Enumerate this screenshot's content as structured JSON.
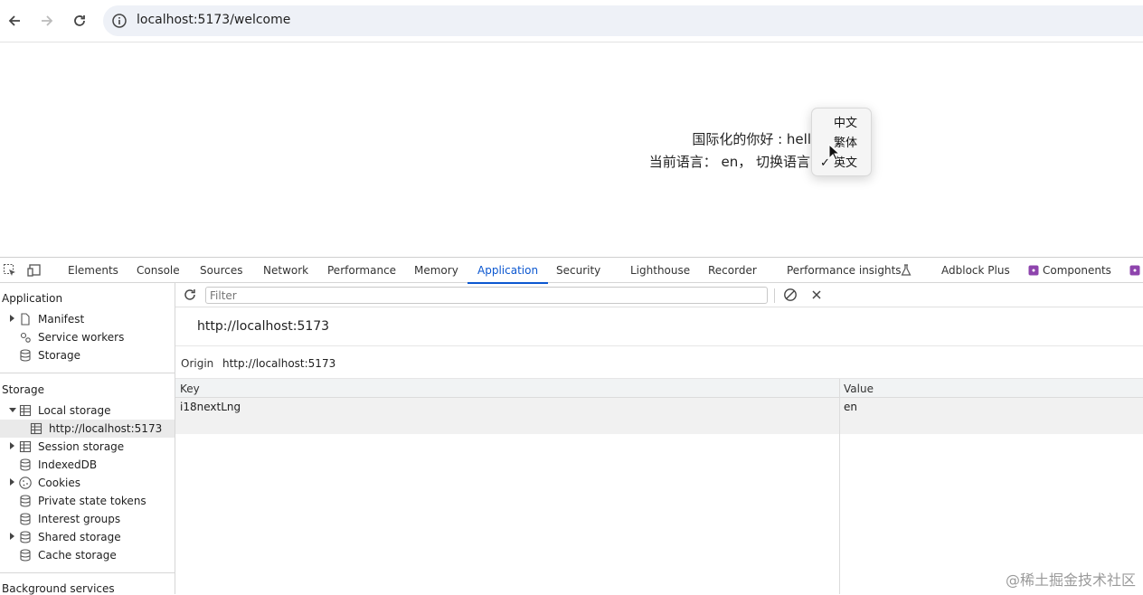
{
  "browser": {
    "url": "localhost:5173/welcome"
  },
  "page": {
    "greeting": "国际化的你好 : hell",
    "current_lang_text": "当前语言：  en，  切换语言"
  },
  "lang_menu": {
    "options": [
      {
        "label": "中文",
        "checked": false
      },
      {
        "label": "繁体",
        "checked": false
      },
      {
        "label": "英文",
        "checked": true
      }
    ],
    "check_mark": "✓"
  },
  "devtools": {
    "tabs": [
      {
        "label": "Elements"
      },
      {
        "label": "Console"
      },
      {
        "label": "Sources"
      },
      {
        "label": "Network"
      },
      {
        "label": "Performance"
      },
      {
        "label": "Memory"
      },
      {
        "label": "Application",
        "active": true
      },
      {
        "label": "Security"
      },
      {
        "label": "Lighthouse"
      },
      {
        "label": "Recorder"
      },
      {
        "label": "Performance insights"
      },
      {
        "label": "Adblock Plus"
      },
      {
        "label": "Components"
      }
    ],
    "sidebar": {
      "application_title": "Application",
      "application_items": [
        {
          "label": "Manifest",
          "icon": "file-icon"
        },
        {
          "label": "Service workers",
          "icon": "gears-icon"
        },
        {
          "label": "Storage",
          "icon": "database-icon"
        }
      ],
      "storage_title": "Storage",
      "storage_items": [
        {
          "label": "Local storage",
          "icon": "table-icon"
        },
        {
          "label": "http://localhost:5173",
          "icon": "table-icon"
        },
        {
          "label": "Session storage",
          "icon": "table-icon"
        },
        {
          "label": "IndexedDB",
          "icon": "database-icon"
        },
        {
          "label": "Cookies",
          "icon": "cookie-icon"
        },
        {
          "label": "Private state tokens",
          "icon": "database-icon"
        },
        {
          "label": "Interest groups",
          "icon": "database-icon"
        },
        {
          "label": "Shared storage",
          "icon": "database-icon"
        },
        {
          "label": "Cache storage",
          "icon": "database-icon"
        }
      ],
      "background_title": "Background services"
    },
    "main": {
      "filter_placeholder": "Filter",
      "origin_title": "http://localhost:5173",
      "origin_label": "Origin",
      "origin_value": "http://localhost:5173",
      "columns": [
        "Key",
        "Value"
      ],
      "rows": [
        {
          "key": "i18nextLng",
          "value": "en"
        }
      ]
    },
    "accent_color": "#0b57d0"
  },
  "watermark": "@稀土掘金技术社区"
}
